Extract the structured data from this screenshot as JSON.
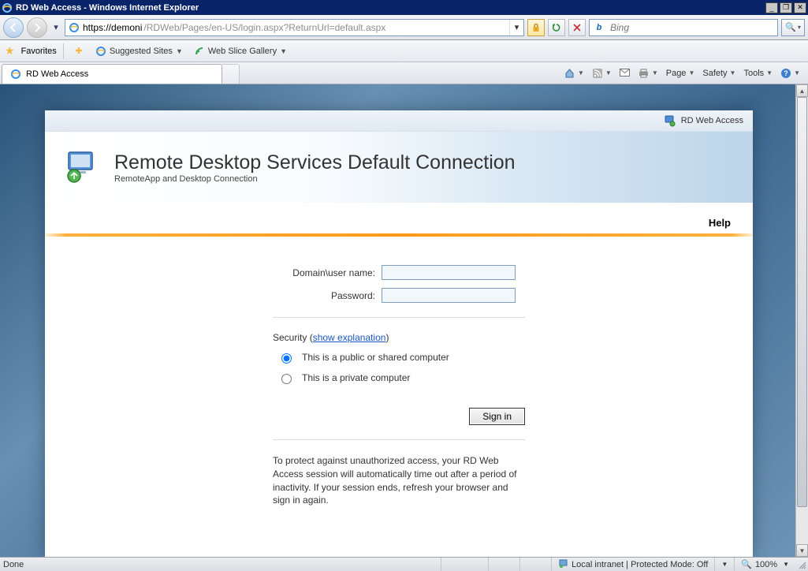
{
  "window": {
    "title": "RD Web Access - Windows Internet Explorer",
    "minimize": "_",
    "restore": "❐",
    "close": "✕"
  },
  "nav": {
    "url_scheme_host": "https://demoni",
    "url_path": "/RDWeb/Pages/en-US/login.aspx?ReturnUrl=default.aspx",
    "refresh": "↻",
    "stop": "✕",
    "search_placeholder": "Bing",
    "search_icon": "b",
    "magnify": "🔍"
  },
  "favbar": {
    "favorites": "Favorites",
    "suggested": "Suggested Sites",
    "webslice": "Web Slice Gallery"
  },
  "tab": {
    "title": "RD Web Access"
  },
  "cmds": {
    "page": "Page",
    "safety": "Safety",
    "tools": "Tools"
  },
  "card_top": {
    "label": "RD Web Access"
  },
  "banner": {
    "title": "Remote Desktop Services Default Connection",
    "subtitle": "RemoteApp and Desktop Connection"
  },
  "help": "Help",
  "form": {
    "user_label": "Domain\\user name:",
    "pass_label": "Password:",
    "security_label": "Security",
    "show_explanation": "show explanation",
    "public_option": "This is a public or shared computer",
    "private_option": "This is a private computer",
    "signin": "Sign in",
    "notice": "To protect against unauthorized access, your RD Web Access session will automatically time out after a period of inactivity. If your session ends, refresh your browser and sign in again."
  },
  "status": {
    "done": "Done",
    "zone": "Local intranet | Protected Mode: Off",
    "zoom": "100%"
  }
}
